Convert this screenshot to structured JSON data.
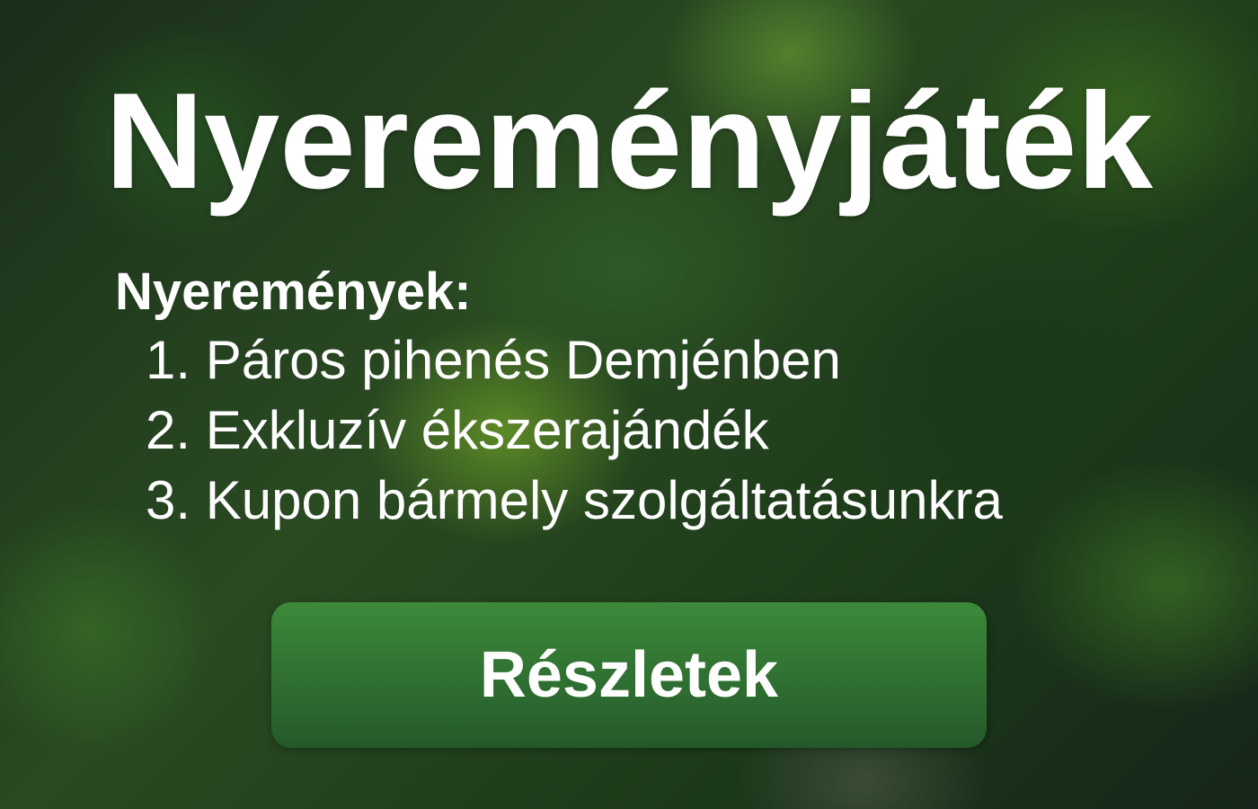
{
  "title": "Nyereményjáték",
  "prizes_heading": "Nyeremények:",
  "prizes": [
    {
      "label": "1. Páros pihenés Demjénben"
    },
    {
      "label": "2. Exkluzív ékszerajándék"
    },
    {
      "label": "3. Kupon bármely szolgáltatásunkra"
    }
  ],
  "button": {
    "label": "Részletek",
    "color": "#3a8538"
  },
  "colors": {
    "background": "#1f3a1c",
    "text": "#ffffff"
  }
}
